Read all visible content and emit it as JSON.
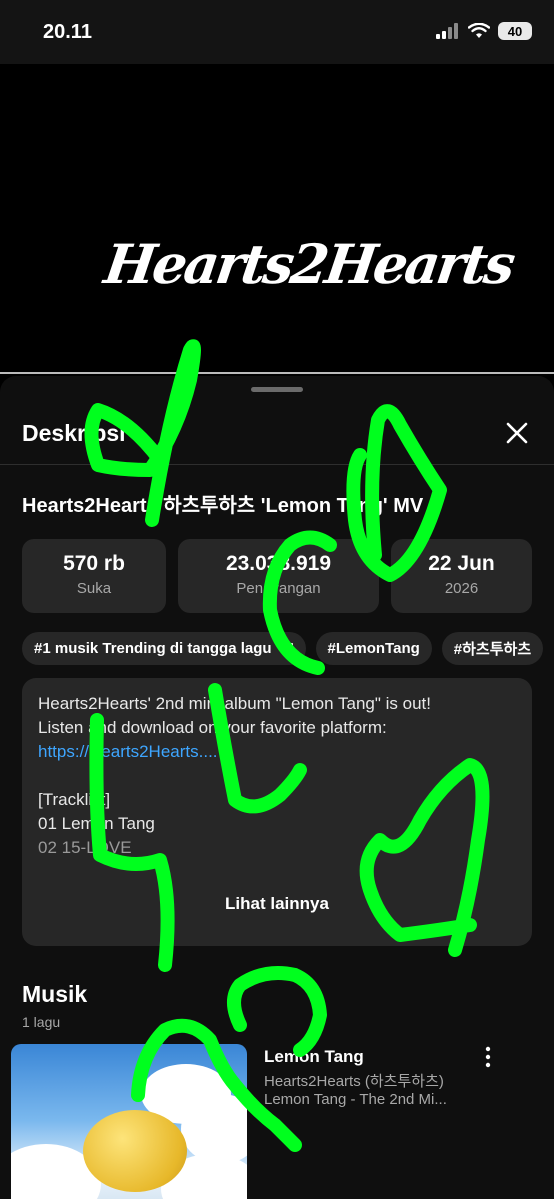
{
  "status_bar": {
    "time": "20.11",
    "battery": "40"
  },
  "video": {
    "logo_text": "Hearts2Hearts"
  },
  "sheet": {
    "title": "Deskripsi",
    "video_title": "Hearts2Hearts 하츠투하츠 'Lemon Tang' MV",
    "stats": [
      {
        "value": "570 rb",
        "label": "Suka"
      },
      {
        "value": "23.038.919",
        "label": "Penayangan"
      },
      {
        "value": "22 Jun",
        "label": "2026"
      }
    ],
    "tags": [
      "#1 musik Trending di tangga lagu",
      "#LemonTang",
      "#하츠투하츠"
    ],
    "description": {
      "line1": "Hearts2Hearts' 2nd mini album \"Lemon Tang\" is out!",
      "line2": "Listen and download on your favorite platform: ",
      "link": "https://Hearts2Hearts....",
      "track_header": "[Tracklist]",
      "track1": "01 Lemon Tang",
      "track2": "02 15-LOVE",
      "more_label": "Lihat lainnya"
    },
    "music_section": {
      "title": "Musik",
      "count": "1 lagu",
      "song": {
        "title": "Lemon Tang",
        "artist": "Hearts2Hearts (하츠투하츠)",
        "album": "Lemon Tang - The 2nd Mi..."
      }
    }
  },
  "colors": {
    "scribble": "#00ff1e",
    "link": "#3ea6ff",
    "card": "#272727"
  }
}
